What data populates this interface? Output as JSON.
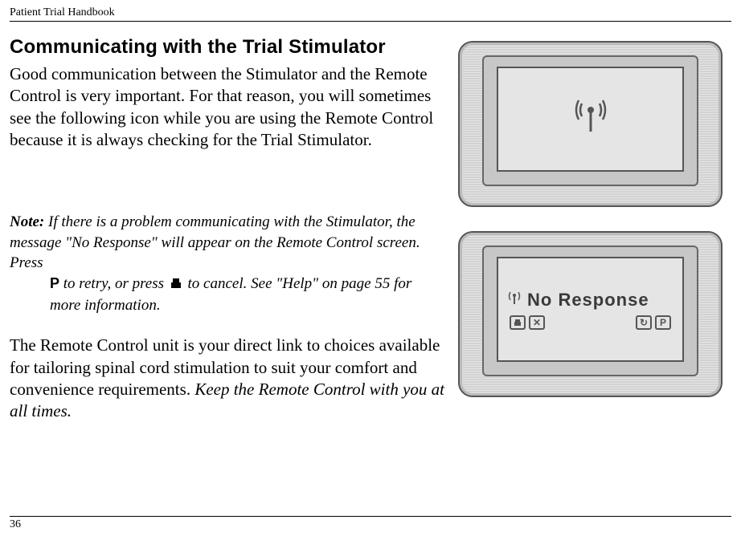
{
  "header": {
    "running_title": "Patient Trial Handbook"
  },
  "section": {
    "title": "Communicating with the Trial Stimulator",
    "intro": "Good communication between the Stimulator and the Remote Control is very important. For that reason, you will sometimes see the following icon while you are using the Remote Control because it is always checking for the Trial Stimulator."
  },
  "note": {
    "label": "Note:",
    "part1": "If there is a problem communicating with the Stimulator, the message \"No Response\" will appear on the Remote Control screen. Press ",
    "p_icon": "P",
    "part2": "to retry, or press ",
    "part3": " to cancel. See \"Help\" on page 55 for more information."
  },
  "closing": {
    "text": "The Remote Control unit is your direct link to choices available for tailoring spinal cord stimulation to suit your comfort and convenience requirements. ",
    "emphasis": "Keep the Remote Control with you at all times."
  },
  "screen2": {
    "title": "No Response",
    "icon_x": "✕",
    "icon_refresh": "↻",
    "icon_p": "P"
  },
  "page_number": "36"
}
